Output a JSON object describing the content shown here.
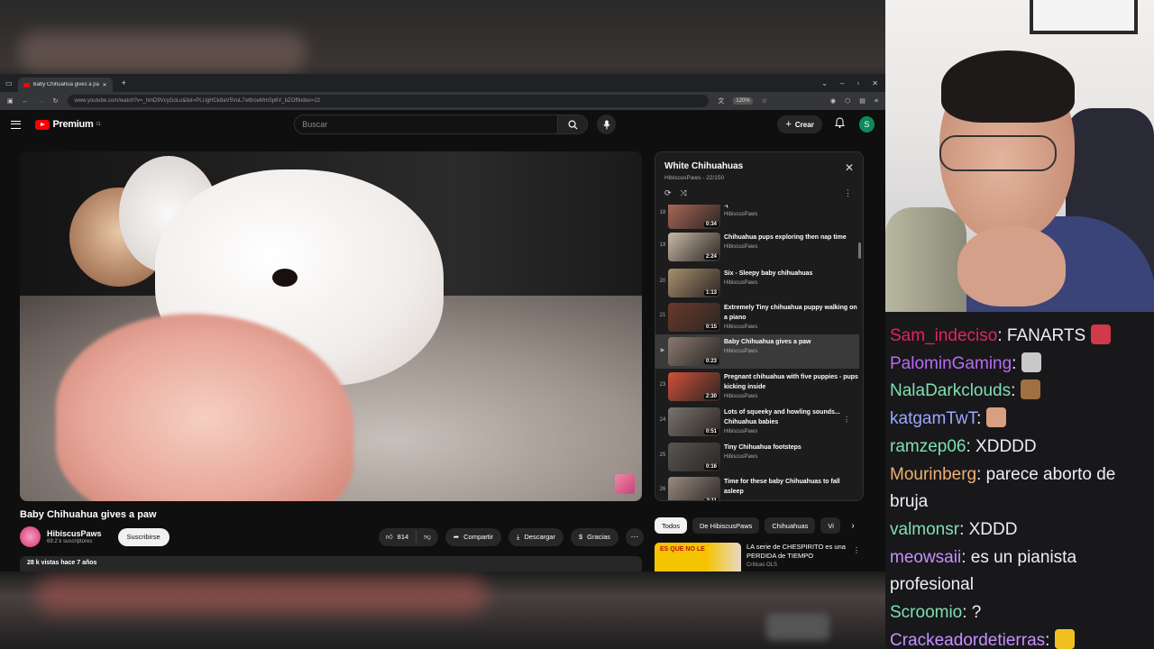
{
  "browser": {
    "tab_title": "Baby Chihuahua gives a pa",
    "url": "www.youtube.com/watch?v=_hmD9VcyGoLo&list=PLUgHCk8aV5VuL7w9rceMmSp6V_bZOffindex=22",
    "zoom": "120%"
  },
  "yt": {
    "logo": "Premium",
    "logo_sup": "CL",
    "search_placeholder": "Buscar",
    "create_label": "Crear",
    "avatar_letter": "S"
  },
  "video": {
    "title": "Baby Chihuahua gives a paw",
    "channel": "HibiscusPaws",
    "subscribers": "69.2 k suscriptores",
    "subscribe_label": "Suscribirse",
    "likes": "814",
    "share_label": "Compartir",
    "download_label": "Descargar",
    "thanks_label": "Gracias",
    "views_meta": "28 k vistas  hace 7 años"
  },
  "playlist": {
    "title": "White Chihuahuas",
    "subtitle": "HibiscusPaws - 22/150",
    "items": [
      {
        "num": "18",
        "title": ":(",
        "channel": "HibiscusPaws",
        "duration": "0:34",
        "thumb": "#b06a5a"
      },
      {
        "num": "19",
        "title": "Chihuahua pups exploring then nap time",
        "channel": "HibiscusPaws",
        "duration": "2:24",
        "thumb": "#c9b8a8"
      },
      {
        "num": "20",
        "title": "Six - Sleepy baby chihuahuas",
        "channel": "HibiscusPaws",
        "duration": "1:13",
        "thumb": "#a89070"
      },
      {
        "num": "21",
        "title": "Extremely Tiny chihuahua puppy walking on a piano",
        "channel": "HibiscusPaws",
        "duration": "0:15",
        "thumb": "#6a3a2a"
      },
      {
        "num": "▶",
        "title": "Baby Chihuahua gives a paw",
        "channel": "HibiscusPaws",
        "duration": "0:23",
        "thumb": "#8a7a70"
      },
      {
        "num": "23",
        "title": "Pregnant chihuahua with five puppies - pups kicking inside",
        "channel": "HibiscusPaws",
        "duration": "2:30",
        "thumb": "#d0503a"
      },
      {
        "num": "24",
        "title": "Lots of squeeky and howling sounds... Chihuahua babies",
        "channel": "HibiscusPaws",
        "duration": "0:51",
        "thumb": "#7a7470"
      },
      {
        "num": "25",
        "title": "Tiny Chihuahua footsteps",
        "channel": "HibiscusPaws",
        "duration": "0:16",
        "thumb": "#5a5652"
      },
      {
        "num": "26",
        "title": "Time for these baby Chihuahuas to fall asleep",
        "channel": "",
        "duration": "2:11",
        "thumb": "#9a8a80"
      }
    ]
  },
  "chips": [
    "Todos",
    "De HibiscusPaws",
    "Chihuahuas",
    "Vi"
  ],
  "recommendation": {
    "thumb_text": "ES QUE NO LE",
    "title": "LA serie de CHESPIRITO es una PERDIDA de TIEMPO",
    "channel": "Críticas OLS"
  },
  "chat": [
    {
      "user": "Sam_indeciso",
      "color": "#e0245e",
      "text": " FANARTS",
      "emote": "#d03a4a"
    },
    {
      "user": "PalominGaming",
      "color": "#b86bf0",
      "text": "",
      "emote": "#c8c8c8"
    },
    {
      "user": "NalaDarkclouds",
      "color": "#7fe0b0",
      "text": "",
      "emote": "#a07040"
    },
    {
      "user": "katgamTwT",
      "color": "#9aa8ff",
      "text": "",
      "emote": "#d8a080"
    },
    {
      "user": "ramzep06",
      "color": "#7fe0b0",
      "text": " XDDDD",
      "emote": ""
    },
    {
      "user": "Mourinberg",
      "color": "#f0b070",
      "text": " parece aborto de bruja",
      "emote": ""
    },
    {
      "user": "valmonsr",
      "color": "#7fe0b0",
      "text": " XDDD",
      "emote": ""
    },
    {
      "user": "meowsaii",
      "color": "#c890ff",
      "text": " es un pianista profesional",
      "emote": ""
    },
    {
      "user": "Scroomio",
      "color": "#7fe0b0",
      "text": " ?",
      "emote": ""
    },
    {
      "user": "Crackeadordetierras",
      "color": "#c890ff",
      "text": "",
      "emote": "#f0c020"
    }
  ]
}
